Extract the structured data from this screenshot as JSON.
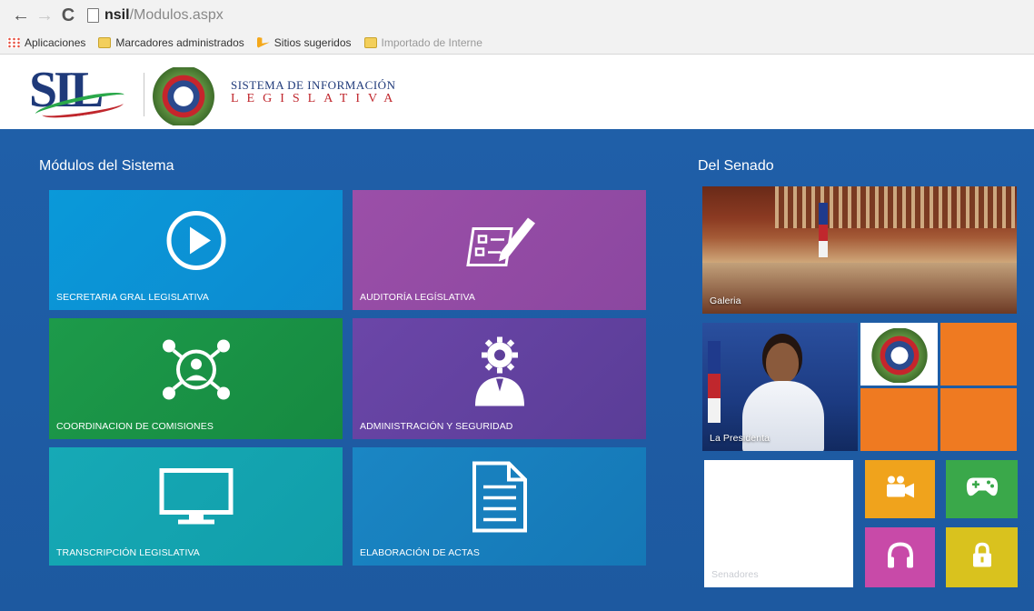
{
  "browser": {
    "url_host": "nsil",
    "url_path": "/Modulos.aspx",
    "bookmarks": [
      {
        "label": "Aplicaciones"
      },
      {
        "label": "Marcadores administrados"
      },
      {
        "label": "Sitios sugeridos"
      },
      {
        "label": "Importado de Interne"
      }
    ]
  },
  "header": {
    "logo_text": "SIL",
    "brand_line1": "SISTEMA DE INFORMACIÓN",
    "brand_line2": "LEGISLATIVA"
  },
  "modules": {
    "title": "Módulos del Sistema",
    "tiles": [
      {
        "label": "SECRETARIA GRAL LEGISLATIVA",
        "icon": "play-circle-icon",
        "color": "#0a99d9"
      },
      {
        "label": "AUDITORÍA LEGÍSLATIVA",
        "icon": "checklist-pencil-icon",
        "color": "#9b4fa8"
      },
      {
        "label": "COORDINACION DE COMISIONES",
        "icon": "network-users-icon",
        "color": "#1d9a4a"
      },
      {
        "label": "ADMINISTRACIÓN Y SEGURIDAD",
        "icon": "user-gear-icon",
        "color": "#6b46a8"
      },
      {
        "label": "TRANSCRIPCIÓN LEGISLATIVA",
        "icon": "monitor-icon",
        "color": "#16a9b6"
      },
      {
        "label": "ELABORACIÓN DE ACTAS",
        "icon": "document-icon",
        "color": "#1a86c4"
      }
    ]
  },
  "senado": {
    "title": "Del Senado",
    "galeria_label": "Galeria",
    "presidenta_label": "La Presidenta",
    "senadores_label": "Senadores",
    "small_tiles": [
      {
        "icon": "video-camera-icon",
        "color": "#f0a31c"
      },
      {
        "icon": "gamepad-icon",
        "color": "#3aa84a"
      },
      {
        "icon": "headphones-icon",
        "color": "#c84aa8"
      },
      {
        "icon": "lock-icon",
        "color": "#d9c21e"
      }
    ],
    "accent_orange": "#ef7a21"
  },
  "colors": {
    "main_background": "#1f5fa8"
  }
}
